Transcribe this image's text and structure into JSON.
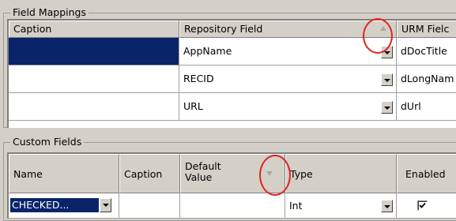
{
  "field_mappings": {
    "title": "Field Mappings",
    "headers": {
      "caption": "Caption",
      "repository_field": "Repository Field",
      "urm_field": "URM Fielc"
    },
    "sort_indicator": "sort-ascending-icon",
    "rows": [
      {
        "caption": "",
        "repository_field": "AppName",
        "urm_field": "dDocTitle"
      },
      {
        "caption": "",
        "repository_field": "RECID",
        "urm_field": "dLongNam"
      },
      {
        "caption": "",
        "repository_field": "URL",
        "urm_field": "dUrl"
      }
    ]
  },
  "custom_fields": {
    "title": "Custom Fields",
    "headers": {
      "name": "Name",
      "caption": "Caption",
      "default_value": "Default Value",
      "type": "Type",
      "enabled": "Enabled"
    },
    "sort_indicator": "sort-descending-icon",
    "rows": [
      {
        "name": "CHECKED...",
        "caption": "",
        "default_value": "",
        "type": "Int",
        "enabled": true
      }
    ]
  },
  "colors": {
    "selection": "#0a246a",
    "highlight_circle": "#e0221e",
    "chrome": "#d4d0c8"
  }
}
